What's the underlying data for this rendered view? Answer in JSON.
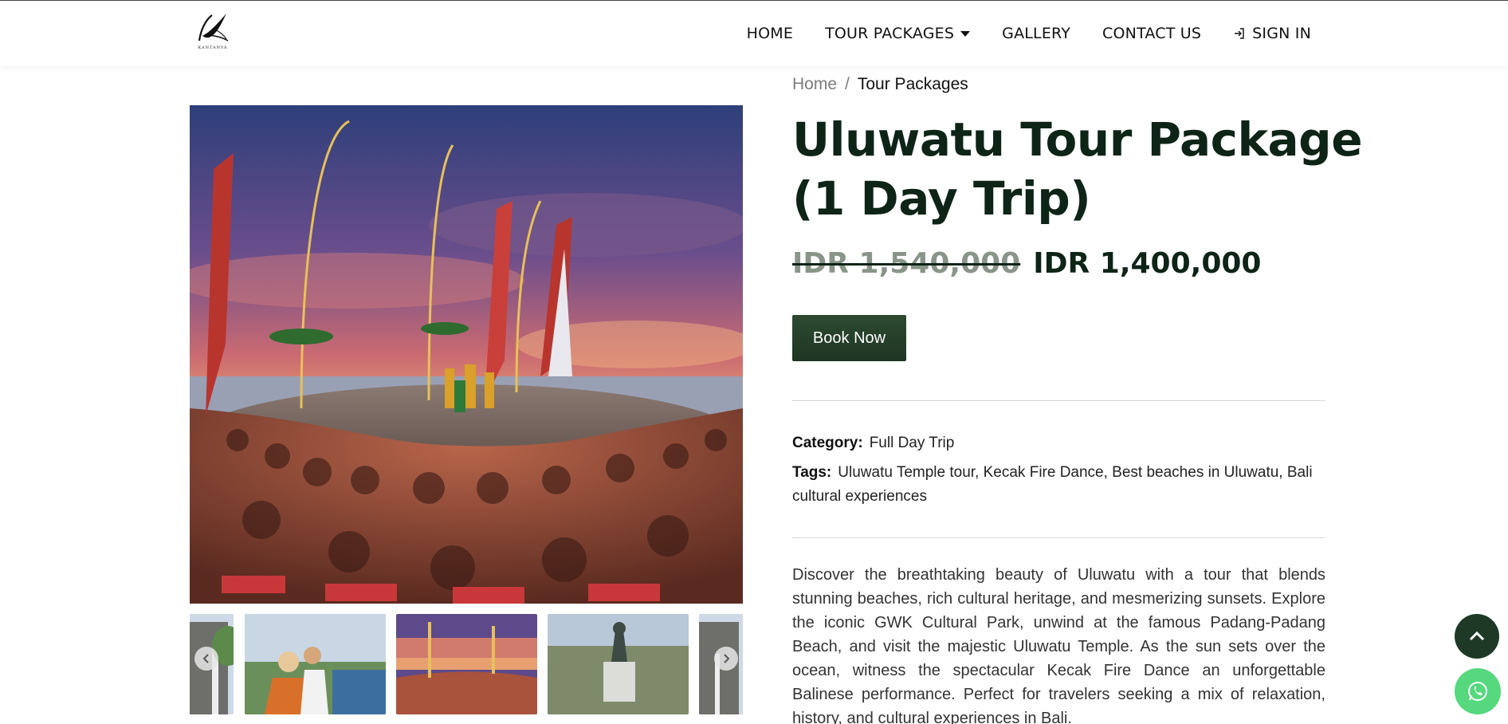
{
  "header": {
    "logo_text": "KANTANYA",
    "nav": {
      "home": "HOME",
      "tour_packages": "TOUR PACKAGES",
      "gallery": "GALLERY",
      "contact": "CONTACT US",
      "sign_in": "SIGN IN"
    }
  },
  "breadcrumb": {
    "home": "Home",
    "separator": "/",
    "current": "Tour Packages"
  },
  "product": {
    "title": "Uluwatu Tour Package (1 Day Trip)",
    "price_old": "IDR 1,540,000",
    "price_new": "IDR 1,400,000",
    "book_label": "Book Now",
    "category_label": "Category:",
    "category_value": "Full Day Trip",
    "tags_label": "Tags:",
    "tags_value": "Uluwatu Temple tour, Kecak Fire Dance, Best beaches in Uluwatu, Bali cultural experiences",
    "description": "Discover the breathtaking beauty of Uluwatu with a tour that blends stunning beaches, rich cultural heritage, and mesmerizing sunsets. Explore the iconic GWK Cultural Park, unwind at the famous Padang-Padang Beach, and visit the majestic Uluwatu Temple. As the sun sets over the ocean, witness the spectacular Kecak Fire Dance an unforgettable Balinese performance. Perfect for travelers seeking a mix of relaxation, history, and cultural experiences in Bali."
  },
  "colors": {
    "brand_dark": "#0d2417",
    "button": "#2d4a31",
    "whatsapp": "#55d87e"
  },
  "icons": [
    "sign-in-icon",
    "caret-down-icon",
    "chevron-left-icon",
    "chevron-right-icon",
    "chevron-up-icon",
    "whatsapp-icon"
  ]
}
